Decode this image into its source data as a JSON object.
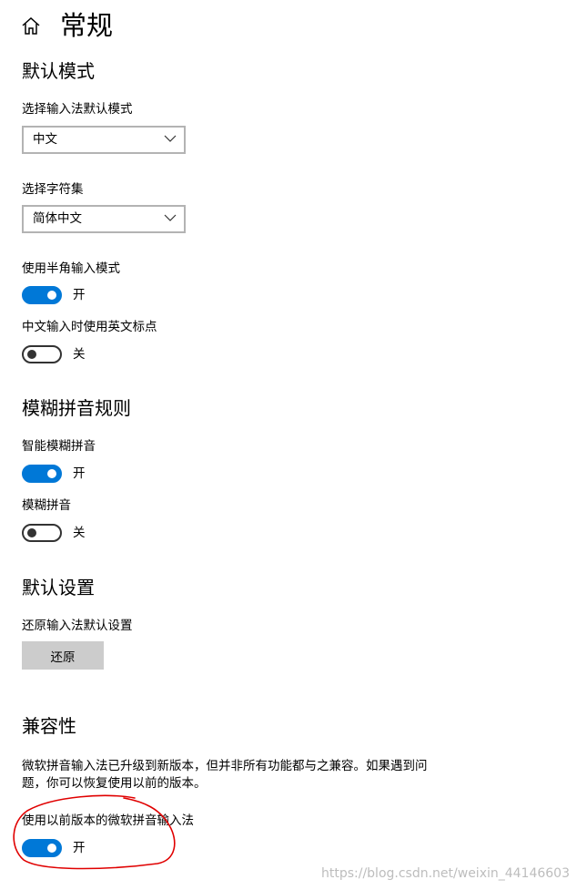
{
  "header": {
    "home_icon": "home-icon",
    "title": "常规"
  },
  "default_mode": {
    "heading": "默认模式",
    "input_mode": {
      "label": "选择输入法默认模式",
      "value": "中文"
    },
    "charset": {
      "label": "选择字符集",
      "value": "简体中文"
    },
    "half_width": {
      "label": "使用半角输入模式",
      "state": "on",
      "state_label": "开"
    },
    "english_punct": {
      "label": "中文输入时使用英文标点",
      "state": "off",
      "state_label": "关"
    }
  },
  "fuzzy_pinyin": {
    "heading": "模糊拼音规则",
    "smart_fuzzy": {
      "label": "智能模糊拼音",
      "state": "on",
      "state_label": "开"
    },
    "fuzzy": {
      "label": "模糊拼音",
      "state": "off",
      "state_label": "关"
    }
  },
  "default_settings": {
    "heading": "默认设置",
    "restore_label": "还原输入法默认设置",
    "restore_button": "还原"
  },
  "compatibility": {
    "heading": "兼容性",
    "description": "微软拼音输入法已升级到新版本，但并非所有功能都与之兼容。如果遇到问题，你可以恢复使用以前的版本。",
    "use_previous": {
      "label": "使用以前版本的微软拼音输入法",
      "state": "on",
      "state_label": "开"
    }
  },
  "colors": {
    "accent": "#0078d7",
    "annotation": "#e00000",
    "button_bg": "#cccccc",
    "watermark": "#bdbdbd"
  },
  "watermark": "https://blog.csdn.net/weixin_44146603"
}
